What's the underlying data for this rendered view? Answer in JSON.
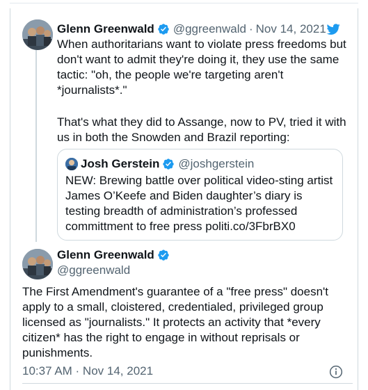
{
  "tweet_reply": {
    "author_name": "Glenn Greenwald",
    "author_handle": "@ggreenwald",
    "separator": "·",
    "date": "Nov 14, 2021",
    "text_paragraph_1": "When authoritarians want to violate press freedoms but don't want to admit they're doing it, they use the same tactic: \"oh, the people we're targeting aren't *journalists*.\"",
    "text_paragraph_2": "That's what they did to Assange, now to PV, tried it with us in both the Snowden and Brazil reporting:"
  },
  "quoted_tweet": {
    "author_name": "Josh Gerstein",
    "author_handle": "@joshgerstein",
    "text": "NEW: Brewing battle over political video-sting artist James O’Keefe and Biden daughter’s diary is testing breadth of administration’s professed committment to free press ",
    "link": "politi.co/3FbrBX0"
  },
  "main_tweet": {
    "author_name": "Glenn Greenwald",
    "author_handle": "@ggreenwald",
    "text": "The First Amendment's guarantee of a \"free press\" doesn't apply to a small, cloistered, credentialed, privileged group licensed as \"journalists.\" It protects an activity that *every citizen* has the right to engage in without reprisals or punishments.",
    "timestamp": "10:37 AM · Nov 14, 2021"
  },
  "icons": {
    "verified": "verified-badge-icon",
    "twitter": "twitter-bird-icon",
    "info": "info-icon"
  },
  "colors": {
    "twitter_blue": "#1d9bf0",
    "text_primary": "#0f1419",
    "text_secondary": "#536471",
    "border": "#cfd9de"
  }
}
